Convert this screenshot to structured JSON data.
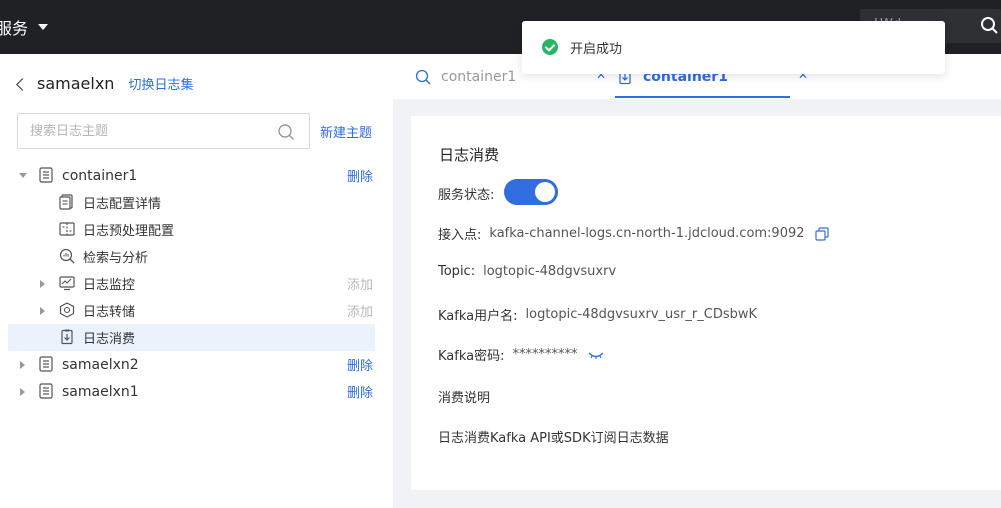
{
  "topbar": {
    "menu_label": "服务",
    "search_text": "LWd... "
  },
  "left": {
    "back_name": "samaelxn",
    "switch_label": "切换日志集",
    "search_placeholder": "搜索日志主题",
    "new_topic": "新建主题",
    "tree": {
      "container1": {
        "label": "container1",
        "action": "删除"
      },
      "children": [
        {
          "label": "日志配置详情"
        },
        {
          "label": "日志预处理配置"
        },
        {
          "label": "检索与分析"
        },
        {
          "label": "日志监控",
          "action": "添加"
        },
        {
          "label": "日志转储",
          "action": "添加"
        },
        {
          "label": "日志消费"
        }
      ],
      "samaelxn2": {
        "label": "samaelxn2",
        "action": "删除"
      },
      "samaelxn1": {
        "label": "samaelxn1",
        "action": "删除"
      }
    }
  },
  "tabs": [
    {
      "label": "container1",
      "icon": "search-icon"
    },
    {
      "label": "container1",
      "icon": "consume-icon"
    }
  ],
  "toast": {
    "message": "开启成功"
  },
  "card": {
    "title": "日志消费",
    "service_status_label": "服务状态:",
    "service_status_on": true,
    "endpoint_label": "接入点:",
    "endpoint_value": "kafka-channel-logs.cn-north-1.jdcloud.com:9092",
    "topic_label": "Topic:",
    "topic_value": "logtopic-48dgvsuxrv",
    "user_label": "Kafka用户名:",
    "user_value": "logtopic-48dgvsuxrv_usr_r_CDsbwK",
    "password_label": "Kafka密码:",
    "password_value": "**********",
    "desc_title": "消费说明",
    "desc_text": "日志消费Kafka API或SDK订阅日志数据"
  },
  "colors": {
    "accent": "#2f6de1",
    "topbar": "#202124",
    "success": "#28b665",
    "panel_bg": "#f1f2f5",
    "active_row": "#eaf3fd"
  }
}
